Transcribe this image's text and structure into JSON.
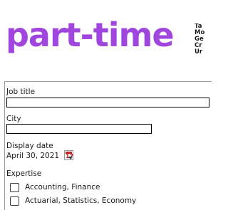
{
  "header": {
    "logo_text": "part-time",
    "logo_color": "#a046de",
    "tagline_lines": [
      "Ta",
      "Mo",
      "Ge",
      "Cr",
      "Ur"
    ]
  },
  "form": {
    "job_title_label": "Job title",
    "job_title_value": "",
    "city_label": "City",
    "city_value": "",
    "display_date_label": "Display date",
    "display_date_value": "April 30, 2021",
    "calendar_button_day": "17",
    "expertise_label": "Expertise",
    "expertise_options": [
      {
        "label": "Accounting, Finance",
        "checked": false
      },
      {
        "label": "Actuarial, Statistics, Economy",
        "checked": false
      }
    ]
  }
}
